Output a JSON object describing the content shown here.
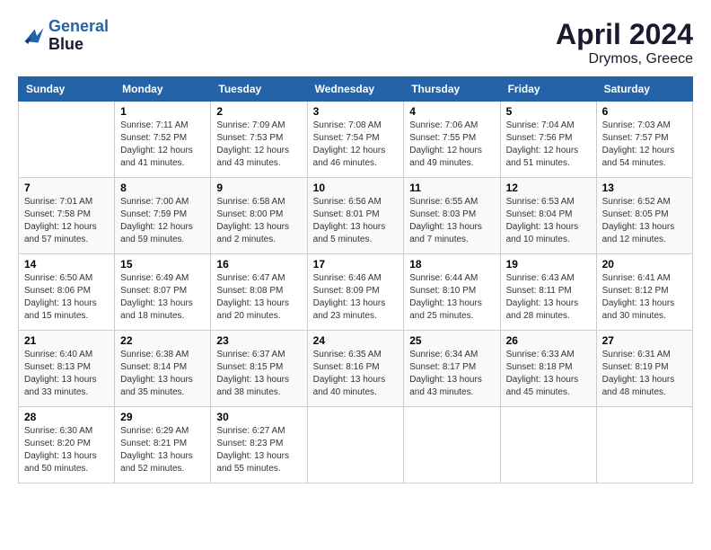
{
  "header": {
    "logo": {
      "line1": "General",
      "line2": "Blue"
    },
    "title": "April 2024",
    "location": "Drymos, Greece"
  },
  "days_of_week": [
    "Sunday",
    "Monday",
    "Tuesday",
    "Wednesday",
    "Thursday",
    "Friday",
    "Saturday"
  ],
  "weeks": [
    [
      {
        "day": "",
        "sunrise": "",
        "sunset": "",
        "daylight": ""
      },
      {
        "day": "1",
        "sunrise": "Sunrise: 7:11 AM",
        "sunset": "Sunset: 7:52 PM",
        "daylight": "Daylight: 12 hours and 41 minutes."
      },
      {
        "day": "2",
        "sunrise": "Sunrise: 7:09 AM",
        "sunset": "Sunset: 7:53 PM",
        "daylight": "Daylight: 12 hours and 43 minutes."
      },
      {
        "day": "3",
        "sunrise": "Sunrise: 7:08 AM",
        "sunset": "Sunset: 7:54 PM",
        "daylight": "Daylight: 12 hours and 46 minutes."
      },
      {
        "day": "4",
        "sunrise": "Sunrise: 7:06 AM",
        "sunset": "Sunset: 7:55 PM",
        "daylight": "Daylight: 12 hours and 49 minutes."
      },
      {
        "day": "5",
        "sunrise": "Sunrise: 7:04 AM",
        "sunset": "Sunset: 7:56 PM",
        "daylight": "Daylight: 12 hours and 51 minutes."
      },
      {
        "day": "6",
        "sunrise": "Sunrise: 7:03 AM",
        "sunset": "Sunset: 7:57 PM",
        "daylight": "Daylight: 12 hours and 54 minutes."
      }
    ],
    [
      {
        "day": "7",
        "sunrise": "Sunrise: 7:01 AM",
        "sunset": "Sunset: 7:58 PM",
        "daylight": "Daylight: 12 hours and 57 minutes."
      },
      {
        "day": "8",
        "sunrise": "Sunrise: 7:00 AM",
        "sunset": "Sunset: 7:59 PM",
        "daylight": "Daylight: 12 hours and 59 minutes."
      },
      {
        "day": "9",
        "sunrise": "Sunrise: 6:58 AM",
        "sunset": "Sunset: 8:00 PM",
        "daylight": "Daylight: 13 hours and 2 minutes."
      },
      {
        "day": "10",
        "sunrise": "Sunrise: 6:56 AM",
        "sunset": "Sunset: 8:01 PM",
        "daylight": "Daylight: 13 hours and 5 minutes."
      },
      {
        "day": "11",
        "sunrise": "Sunrise: 6:55 AM",
        "sunset": "Sunset: 8:03 PM",
        "daylight": "Daylight: 13 hours and 7 minutes."
      },
      {
        "day": "12",
        "sunrise": "Sunrise: 6:53 AM",
        "sunset": "Sunset: 8:04 PM",
        "daylight": "Daylight: 13 hours and 10 minutes."
      },
      {
        "day": "13",
        "sunrise": "Sunrise: 6:52 AM",
        "sunset": "Sunset: 8:05 PM",
        "daylight": "Daylight: 13 hours and 12 minutes."
      }
    ],
    [
      {
        "day": "14",
        "sunrise": "Sunrise: 6:50 AM",
        "sunset": "Sunset: 8:06 PM",
        "daylight": "Daylight: 13 hours and 15 minutes."
      },
      {
        "day": "15",
        "sunrise": "Sunrise: 6:49 AM",
        "sunset": "Sunset: 8:07 PM",
        "daylight": "Daylight: 13 hours and 18 minutes."
      },
      {
        "day": "16",
        "sunrise": "Sunrise: 6:47 AM",
        "sunset": "Sunset: 8:08 PM",
        "daylight": "Daylight: 13 hours and 20 minutes."
      },
      {
        "day": "17",
        "sunrise": "Sunrise: 6:46 AM",
        "sunset": "Sunset: 8:09 PM",
        "daylight": "Daylight: 13 hours and 23 minutes."
      },
      {
        "day": "18",
        "sunrise": "Sunrise: 6:44 AM",
        "sunset": "Sunset: 8:10 PM",
        "daylight": "Daylight: 13 hours and 25 minutes."
      },
      {
        "day": "19",
        "sunrise": "Sunrise: 6:43 AM",
        "sunset": "Sunset: 8:11 PM",
        "daylight": "Daylight: 13 hours and 28 minutes."
      },
      {
        "day": "20",
        "sunrise": "Sunrise: 6:41 AM",
        "sunset": "Sunset: 8:12 PM",
        "daylight": "Daylight: 13 hours and 30 minutes."
      }
    ],
    [
      {
        "day": "21",
        "sunrise": "Sunrise: 6:40 AM",
        "sunset": "Sunset: 8:13 PM",
        "daylight": "Daylight: 13 hours and 33 minutes."
      },
      {
        "day": "22",
        "sunrise": "Sunrise: 6:38 AM",
        "sunset": "Sunset: 8:14 PM",
        "daylight": "Daylight: 13 hours and 35 minutes."
      },
      {
        "day": "23",
        "sunrise": "Sunrise: 6:37 AM",
        "sunset": "Sunset: 8:15 PM",
        "daylight": "Daylight: 13 hours and 38 minutes."
      },
      {
        "day": "24",
        "sunrise": "Sunrise: 6:35 AM",
        "sunset": "Sunset: 8:16 PM",
        "daylight": "Daylight: 13 hours and 40 minutes."
      },
      {
        "day": "25",
        "sunrise": "Sunrise: 6:34 AM",
        "sunset": "Sunset: 8:17 PM",
        "daylight": "Daylight: 13 hours and 43 minutes."
      },
      {
        "day": "26",
        "sunrise": "Sunrise: 6:33 AM",
        "sunset": "Sunset: 8:18 PM",
        "daylight": "Daylight: 13 hours and 45 minutes."
      },
      {
        "day": "27",
        "sunrise": "Sunrise: 6:31 AM",
        "sunset": "Sunset: 8:19 PM",
        "daylight": "Daylight: 13 hours and 48 minutes."
      }
    ],
    [
      {
        "day": "28",
        "sunrise": "Sunrise: 6:30 AM",
        "sunset": "Sunset: 8:20 PM",
        "daylight": "Daylight: 13 hours and 50 minutes."
      },
      {
        "day": "29",
        "sunrise": "Sunrise: 6:29 AM",
        "sunset": "Sunset: 8:21 PM",
        "daylight": "Daylight: 13 hours and 52 minutes."
      },
      {
        "day": "30",
        "sunrise": "Sunrise: 6:27 AM",
        "sunset": "Sunset: 8:23 PM",
        "daylight": "Daylight: 13 hours and 55 minutes."
      },
      {
        "day": "",
        "sunrise": "",
        "sunset": "",
        "daylight": ""
      },
      {
        "day": "",
        "sunrise": "",
        "sunset": "",
        "daylight": ""
      },
      {
        "day": "",
        "sunrise": "",
        "sunset": "",
        "daylight": ""
      },
      {
        "day": "",
        "sunrise": "",
        "sunset": "",
        "daylight": ""
      }
    ]
  ]
}
